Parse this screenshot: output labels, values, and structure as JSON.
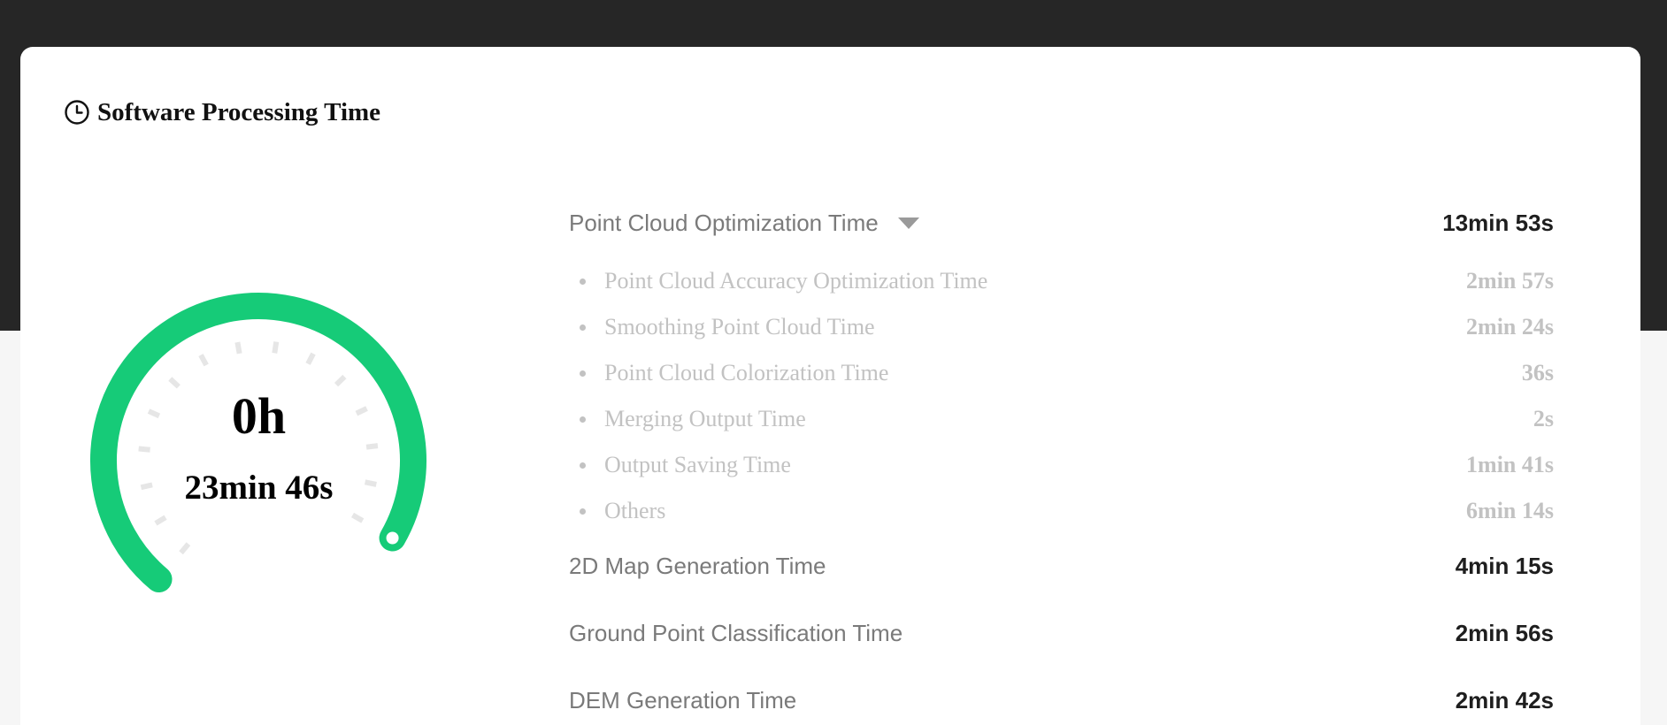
{
  "colors": {
    "accent": "#16cb78",
    "tick": "#e6e6e6",
    "header_band": "#262626"
  },
  "card": {
    "title": "Software Processing Time",
    "title_icon": "clock-icon"
  },
  "gauge": {
    "hours": "0h",
    "minutes_seconds": "23min 46s",
    "progress_fraction": 1.0
  },
  "rows": [
    {
      "label": "Point Cloud Optimization Time",
      "value": "13min 53s",
      "expandable": true,
      "expanded": true
    },
    {
      "label": "2D Map Generation Time",
      "value": "4min 15s"
    },
    {
      "label": "Ground Point Classification Time",
      "value": "2min 56s"
    },
    {
      "label": "DEM Generation Time",
      "value": "2min 42s"
    }
  ],
  "sub_rows": [
    {
      "label": "Point Cloud Accuracy Optimization Time",
      "value": "2min 57s"
    },
    {
      "label": "Smoothing Point Cloud Time",
      "value": "2min 24s"
    },
    {
      "label": "Point Cloud Colorization Time",
      "value": "36s"
    },
    {
      "label": "Merging Output Time",
      "value": "2s"
    },
    {
      "label": "Output Saving Time",
      "value": "1min 41s"
    },
    {
      "label": "Others",
      "value": "6min 14s"
    }
  ]
}
